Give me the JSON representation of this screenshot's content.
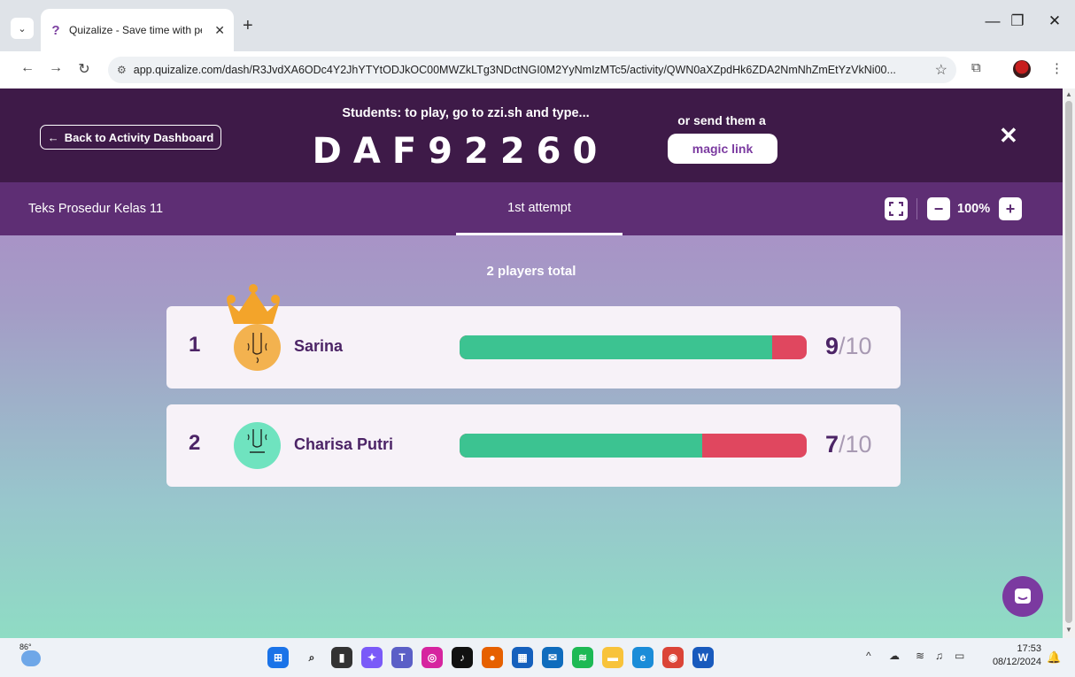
{
  "browser": {
    "tab_title": "Quizalize - Save time with personalised",
    "url": "app.quizalize.com/dash/R3JvdXA6ODc4Y2JhYTYtODJkOC00MWZkLTg3NDctNGI0M2YyNmIzMTc5/activity/QWN0aXZpdHk6ZDA2NmNhZmEtYzVkNi00..."
  },
  "banner": {
    "back_label": "Back to Activity Dashboard",
    "play_text": "Students: to play, go to zzi.sh and type...",
    "code": "DAF92260",
    "send_text": "or send them a",
    "magic_label": "magic link"
  },
  "subbar": {
    "quiz_title": "Teks Prosedur Kelas 11",
    "attempt_tab": "1st attempt",
    "zoom": "100%"
  },
  "leaderboard": {
    "total": "2 players total",
    "players": [
      {
        "rank": "1",
        "name": "Sarina",
        "score": "9",
        "max": "/10",
        "fraction": 0.9,
        "avatar_color": "#f3b24f"
      },
      {
        "rank": "2",
        "name": "Charisa Putri",
        "score": "7",
        "max": "/10",
        "fraction": 0.7,
        "avatar_color": "#6fe3bf"
      }
    ]
  },
  "taskbar": {
    "temperature": "86°",
    "time": "17:53",
    "date": "08/12/2024"
  },
  "colors": {
    "banner": "#3e1a48",
    "subbar": "#5e2e74",
    "correct": "#3cc391",
    "incorrect": "#e0475f",
    "text": "#4c2466"
  }
}
